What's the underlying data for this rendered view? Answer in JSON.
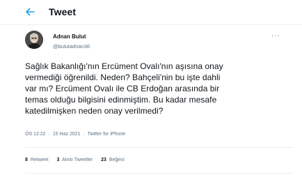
{
  "header": {
    "title": "Tweet",
    "back_icon": "arrow-left-icon",
    "accent": "#1da1f2"
  },
  "tweet": {
    "author_name": "Adnan Bulut",
    "author_handle": "@bulutadnan36",
    "more_icon": "more-dots-icon",
    "text": "Sağlık Bakanlığı'nın Ercüment Ovalı'nın aşısına onay\nvermediği öğrenildi. Neden? Bahçeli'nin bu işte dahli\nvar mı? Ercüment Ovalı ile CB Erdoğan arasında bir\ntemas olduğu bilgisini edinmiştim. Bu kadar mesafe\nkatedilmişken neden onay verilmedi?",
    "time": "ÖS 12:22",
    "separator": "·",
    "date": "15 Haz 2021",
    "source": "Twitter for iPhone"
  },
  "stats": {
    "retweets_count": "8",
    "retweets_label": "Retweet",
    "quotes_count": "3",
    "quotes_label": "Alıntı Tweetler",
    "likes_count": "23",
    "likes_label": "Beğeni"
  }
}
